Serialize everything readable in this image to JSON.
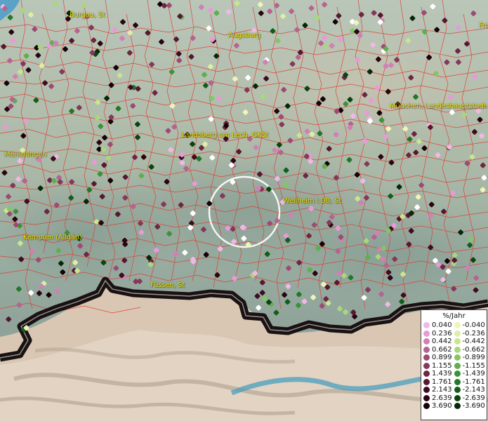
{
  "map": {
    "cities": [
      {
        "name": "Burgau, St"
      },
      {
        "name": "Augsburg"
      },
      {
        "name": "Fre"
      },
      {
        "name": "München, Landeshauptstadt"
      },
      {
        "name": "Landsberg am Lech, GKSt"
      },
      {
        "name": "Memmingen"
      },
      {
        "name": "Weilheim i.OB, St"
      },
      {
        "name": "Kempten (Allgäu)"
      },
      {
        "name": "Füssen, St"
      }
    ]
  },
  "legend": {
    "title": "%/Jahr",
    "rows": [
      {
        "pos": "0.040",
        "pos_color": "#f0b8e6",
        "neg": "-0.040",
        "neg_color": "#eef5b8"
      },
      {
        "pos": "0.236",
        "pos_color": "#e89ad8",
        "neg": "-0.236",
        "neg_color": "#dcefa4"
      },
      {
        "pos": "0.442",
        "pos_color": "#d17fb6",
        "neg": "-0.442",
        "neg_color": "#c7e68e"
      },
      {
        "pos": "0.662",
        "pos_color": "#b66390",
        "neg": "-0.662",
        "neg_color": "#a9d87a"
      },
      {
        "pos": "0.899",
        "pos_color": "#9c4c72",
        "neg": "-0.899",
        "neg_color": "#86c565"
      },
      {
        "pos": "1.155",
        "pos_color": "#85385a",
        "neg": "-1.155",
        "neg_color": "#5fae4f"
      },
      {
        "pos": "1.439",
        "pos_color": "#6e2642",
        "neg": "-1.439",
        "neg_color": "#3d923a"
      },
      {
        "pos": "1.761",
        "pos_color": "#561830",
        "neg": "-1.761",
        "neg_color": "#237828"
      },
      {
        "pos": "2.143",
        "pos_color": "#3e0c20",
        "neg": "-2.143",
        "neg_color": "#135e1a"
      },
      {
        "pos": "2.639",
        "pos_color": "#290510",
        "neg": "-2.639",
        "neg_color": "#0a4410"
      },
      {
        "pos": "3.690",
        "pos_color": "#150106",
        "neg": "-3.690",
        "neg_color": "#042808"
      }
    ]
  }
}
